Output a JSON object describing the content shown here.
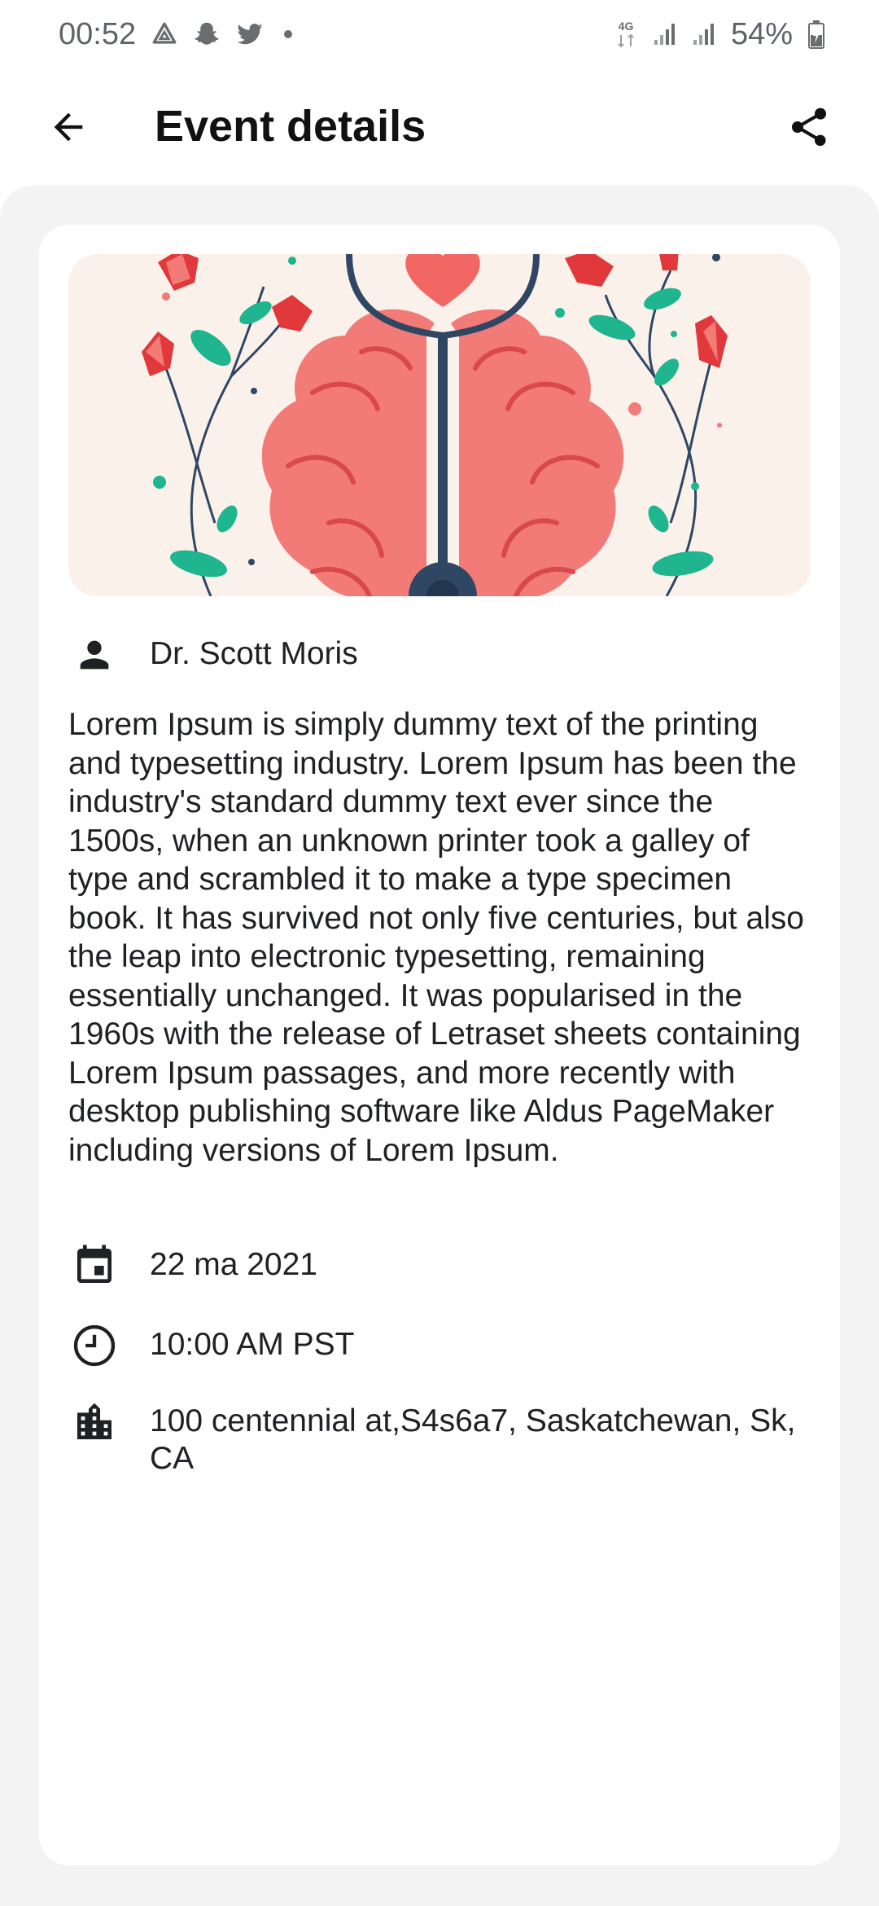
{
  "status_bar": {
    "time": "00:52",
    "battery": "54%",
    "network": "4G"
  },
  "app_bar": {
    "title": "Event details"
  },
  "event": {
    "organizer": "Dr. Scott Moris",
    "description": "Lorem Ipsum is simply dummy text of the printing and typesetting industry. Lorem Ipsum has been the industry's standard dummy text ever since the 1500s, when an unknown printer took a galley of type and scrambled it to make a type specimen book. It has survived not only five centuries, but also the leap into electronic typesetting, remaining essentially unchanged. It was popularised in the 1960s with the release of Letraset sheets containing Lorem Ipsum passages, and more recently with desktop publishing software like Aldus PageMaker including versions of Lorem Ipsum.",
    "date": "22 ma 2021",
    "time": "10:00 AM PST",
    "address": "100 centennial at,S4s6a7, Saskatchewan, Sk, CA"
  },
  "icons": {
    "back": "arrow-back-icon",
    "share": "share-icon",
    "organizer": "person-icon",
    "date": "calendar-icon",
    "time": "clock-icon",
    "address": "building-icon"
  },
  "colors": {
    "sheet_background": "#f3f3f4",
    "card_background": "#ffffff",
    "banner_background": "#fbf1eb",
    "brain": "#f27a77",
    "stethoscope": "#2f4763",
    "leaf": "#1fb58f"
  }
}
